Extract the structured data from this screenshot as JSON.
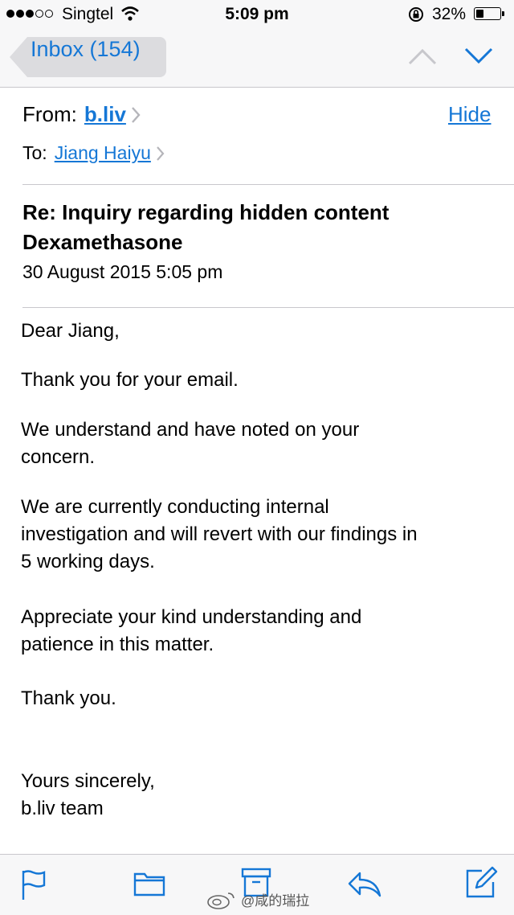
{
  "status_bar": {
    "carrier": "Singtel",
    "time": "5:09 pm",
    "battery": "32%"
  },
  "nav": {
    "back_label": "Inbox (154)"
  },
  "header": {
    "from_label": "From:",
    "from_name": "b.liv",
    "hide_label": "Hide",
    "to_label": "To:",
    "to_name": "Jiang Haiyu"
  },
  "email": {
    "subject_line1": "Re: Inquiry regarding hidden content",
    "subject_line2": "Dexamethasone",
    "date": "30 August 2015 5:05 pm",
    "body": {
      "greeting": "Dear Jiang,",
      "p1": "Thank you for your email.",
      "p2_line1": "We understand and have noted on your",
      "p2_line2": "concern.",
      "p3_line1": "We are currently conducting internal",
      "p3_line2": "investigation and will revert with our findings in",
      "p3_line3": "5 working days.",
      "p4_line1": "Appreciate your kind understanding and",
      "p4_line2": "patience in this matter.",
      "p5": "Thank you.",
      "closing": "Yours sincerely,",
      "signature": "b.liv team"
    }
  },
  "watermark": {
    "text": "@咸的瑞拉"
  },
  "colors": {
    "accent": "#1577d6",
    "bar_bg": "#f7f7f8",
    "separator": "#c8c7cc"
  },
  "icons": {
    "toolbar": [
      "flag-icon",
      "folder-icon",
      "archive-icon",
      "reply-icon",
      "compose-icon"
    ]
  }
}
